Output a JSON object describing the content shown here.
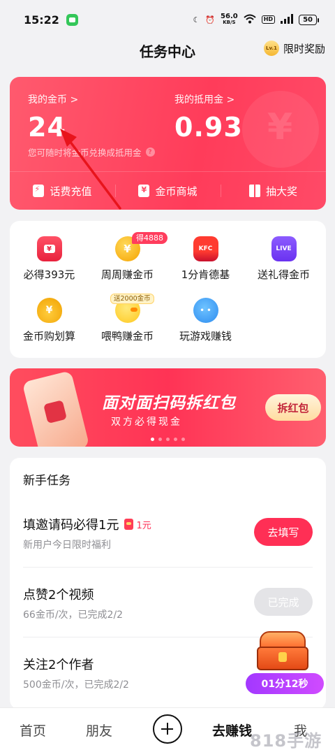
{
  "status_bar": {
    "time": "15:22",
    "net_speed": "56.0",
    "net_unit": "KB/S",
    "hd": "HD",
    "battery": "50"
  },
  "header": {
    "title": "任务中心",
    "level_badge": "Lv.1",
    "limited_reward": "限时奖励"
  },
  "coin_card": {
    "coins_label": "我的金币 >",
    "coins_value": "24",
    "deduction_label": "我的抵用金 >",
    "deduction_value": "0.93",
    "hint": "您可随时将金币兑换成抵用金",
    "actions": [
      {
        "label": "话费充值",
        "icon": "phone-bill-icon"
      },
      {
        "label": "金币商城",
        "icon": "coin-shop-icon"
      },
      {
        "label": "抽大奖",
        "icon": "gift-icon"
      }
    ],
    "colors": {
      "card_start": "#ff5a6e",
      "card_end": "#ff3c5a"
    }
  },
  "grid": {
    "items": [
      {
        "label": "必得393元",
        "icon": "red-packet-icon"
      },
      {
        "label": "周周赚金币",
        "icon": "coin-icon"
      },
      {
        "label": "1分肯德基",
        "icon": "kfc-icon",
        "icon_text": "KFC"
      },
      {
        "label": "送礼得金币",
        "icon": "live-icon",
        "icon_text": "LIVE"
      },
      {
        "label": "金币购划算",
        "icon": "coin-pouch-icon"
      },
      {
        "label": "喂鸭赚金币",
        "icon": "duck-icon"
      },
      {
        "label": "玩游戏赚钱",
        "icon": "game-controller-icon"
      }
    ],
    "badge_weekly": "得4888",
    "badge_duck": "送2000金币"
  },
  "banner": {
    "title": "面对面扫码拆红包",
    "subtitle": "双方必得现金",
    "button": "拆红包"
  },
  "tasks": {
    "heading": "新手任务",
    "rows": [
      {
        "title": "填邀请码必得1元",
        "bonus": "1元",
        "sub": "新用户今日限时福利",
        "button": "去填写",
        "state": "active"
      },
      {
        "title": "点赞2个视频",
        "sub": "66金币/次，已完成2/2",
        "button": "已完成",
        "state": "done"
      },
      {
        "title": "关注2个作者",
        "sub": "500金币/次，已完成2/2",
        "button": "",
        "state": "hidden"
      }
    ]
  },
  "floating": {
    "countdown": "01分12秒"
  },
  "bottom_nav": {
    "home": "首页",
    "friends": "朋友",
    "earn": "去赚钱",
    "me": "我"
  },
  "watermark": "818手游网"
}
